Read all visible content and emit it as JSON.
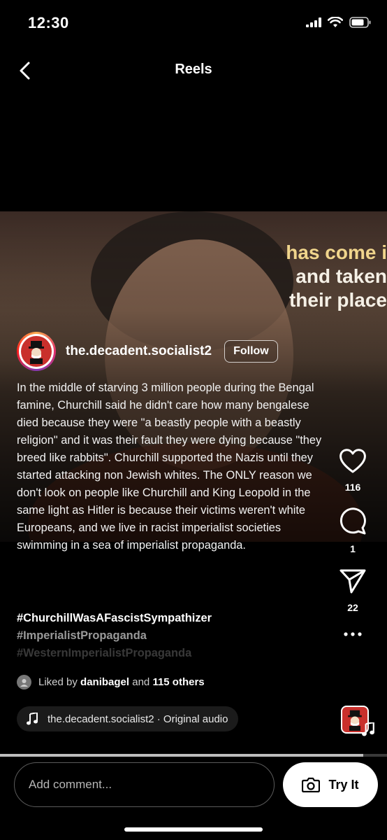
{
  "status_bar": {
    "time": "12:30",
    "icons": [
      "signal-icon",
      "wifi-icon",
      "battery-icon"
    ]
  },
  "header": {
    "title": "Reels",
    "back_icon": "chevron-left-icon"
  },
  "video": {
    "caption_lines": [
      "has come i",
      "and taken",
      "their place"
    ]
  },
  "post": {
    "username": "the.decadent.socialist2",
    "follow_label": "Follow",
    "caption": "In the middle of starving 3 million people during the Bengal famine, Churchill said he didn't care how many bengalese died because they were \"a beastly people with a beastly religion\" and it was their fault they were dying because \"they breed like rabbits\". Churchill supported the Nazis until they started attacking non Jewish whites. The ONLY reason we don't look on people like Churchill and King Leopold in the same light as Hitler is because their victims weren't white Europeans, and we live in racist imperialist societies swimming in a sea of imperialist propaganda.",
    "hashtags": [
      "#ChurchillWasAFascistSympathizer",
      "#ImperialistPropaganda",
      "#WesternImperialistPropaganda"
    ],
    "liked_by": {
      "prefix": "Liked by",
      "user": "danibagel",
      "conjunction": "and",
      "others": "115 others"
    },
    "audio": {
      "label": "the.decadent.socialist2 · Original audio",
      "icon": "music-note-icon"
    }
  },
  "actions": {
    "like": {
      "icon": "heart-icon",
      "count": "116"
    },
    "comment": {
      "icon": "comment-bubble-icon",
      "count": "1"
    },
    "share": {
      "icon": "paper-plane-icon",
      "count": "22"
    },
    "more": {
      "icon": "more-dots-icon"
    }
  },
  "composer": {
    "placeholder": "Add comment...",
    "try_label": "Try It",
    "try_icon": "camera-icon"
  },
  "colors": {
    "background": "#000000",
    "caption_highlight": "#f0d58c",
    "button_bg": "#ffffff",
    "avatar_accent": "#c9302c"
  }
}
